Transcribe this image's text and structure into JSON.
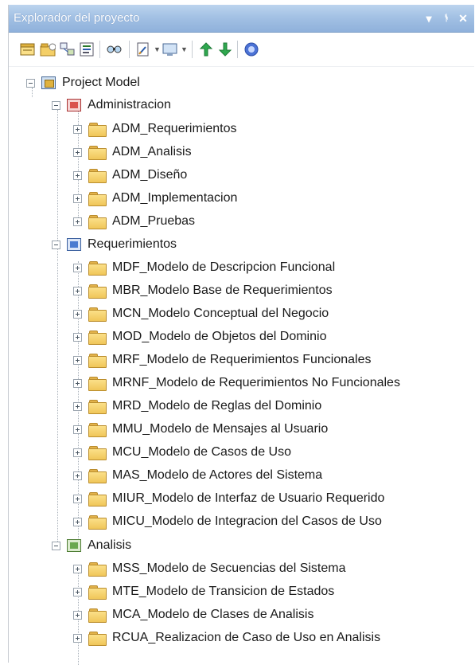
{
  "window": {
    "title": "Explorador del proyecto"
  },
  "title_controls": {
    "dropdown": "▾",
    "pin": "ᚬ",
    "close": "✕"
  },
  "toolbar": {
    "icons": [
      "new-diagram-icon",
      "new-package-icon",
      "new-element-icon",
      "properties-icon",
      "find-icon",
      "document-icon",
      "view-icon",
      "move-up-icon",
      "move-down-icon",
      "help-icon"
    ]
  },
  "colors": {
    "title_bar": "#a3c1e4",
    "folder": "#f0c659",
    "admin_pkg": "#d9534f",
    "req_pkg": "#4a7bd0",
    "analysis_pkg": "#6aa84f"
  },
  "tree": {
    "root": "Project Model",
    "groups": [
      {
        "label": "Administracion",
        "children": [
          "ADM_Requerimientos",
          "ADM_Analisis",
          "ADM_Diseño",
          "ADM_Implementacion",
          "ADM_Pruebas"
        ]
      },
      {
        "label": "Requerimientos",
        "children": [
          "MDF_Modelo de Descripcion Funcional",
          "MBR_Modelo Base de Requerimientos",
          "MCN_Modelo Conceptual del Negocio",
          "MOD_Modelo de Objetos del Dominio",
          "MRF_Modelo de Requerimientos Funcionales",
          "MRNF_Modelo de Requerimientos No Funcionales",
          "MRD_Modelo de Reglas del Dominio",
          "MMU_Modelo de Mensajes al Usuario",
          "MCU_Modelo de Casos de Uso",
          "MAS_Modelo de Actores del Sistema",
          "MIUR_Modelo de Interfaz de Usuario Requerido",
          "MICU_Modelo de Integracion del Casos de Uso"
        ]
      },
      {
        "label": "Analisis",
        "children": [
          "MSS_Modelo de Secuencias del Sistema",
          "MTE_Modelo de Transicion de Estados",
          "MCA_Modelo de Clases de Analisis",
          "RCUA_Realizacion de Caso de Uso en Analisis"
        ]
      }
    ]
  }
}
